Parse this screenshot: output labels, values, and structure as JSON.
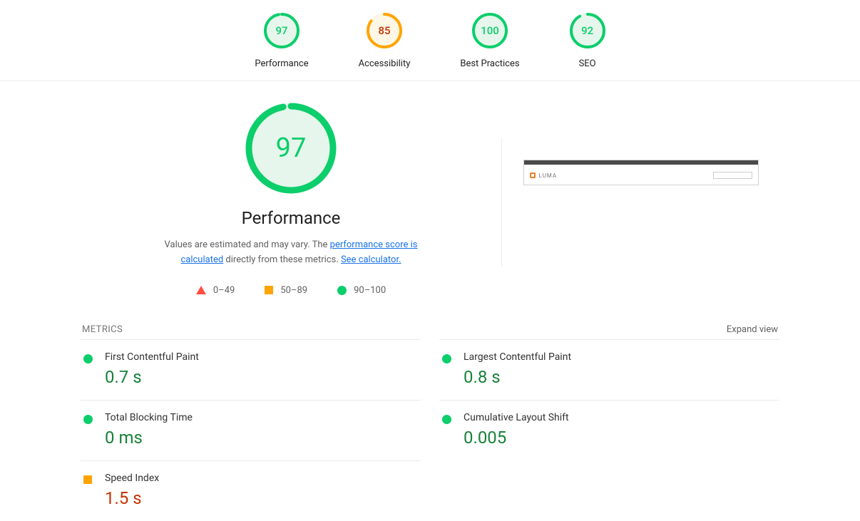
{
  "scores": [
    {
      "label": "Performance",
      "value": 97,
      "status": "green"
    },
    {
      "label": "Accessibility",
      "value": 85,
      "status": "orange"
    },
    {
      "label": "Best Practices",
      "value": 100,
      "status": "green"
    },
    {
      "label": "SEO",
      "value": 92,
      "status": "green"
    }
  ],
  "hero": {
    "big_score": 97,
    "title": "Performance",
    "desc_prefix": "Values are estimated and may vary. The ",
    "link1": "performance score is calculated",
    "desc_mid": " directly from these metrics. ",
    "link2": "See calculator."
  },
  "legend": {
    "fail": "0–49",
    "avg": "50–89",
    "pass": "90–100"
  },
  "thumbnail": {
    "brand": "LUMA"
  },
  "metrics": {
    "heading": "METRICS",
    "expand": "Expand view",
    "items": [
      {
        "label": "First Contentful Paint",
        "value": "0.7 s",
        "status": "green"
      },
      {
        "label": "Largest Contentful Paint",
        "value": "0.8 s",
        "status": "green"
      },
      {
        "label": "Total Blocking Time",
        "value": "0 ms",
        "status": "green"
      },
      {
        "label": "Cumulative Layout Shift",
        "value": "0.005",
        "status": "green"
      },
      {
        "label": "Speed Index",
        "value": "1.5 s",
        "status": "orange"
      }
    ]
  }
}
